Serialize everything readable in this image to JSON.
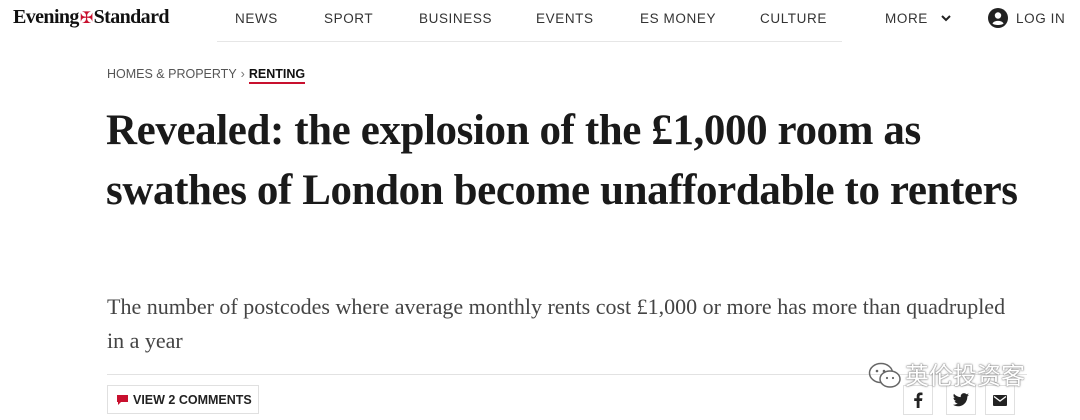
{
  "brand": {
    "logo_left": "Evening",
    "logo_right": "Standard",
    "accent": "#c8102e"
  },
  "nav": {
    "items": [
      "NEWS",
      "SPORT",
      "BUSINESS",
      "EVENTS",
      "ES MONEY",
      "CULTURE"
    ],
    "more_label": "MORE",
    "login_label": "LOG IN"
  },
  "breadcrumb": {
    "parent": "HOMES & PROPERTY",
    "separator": "›",
    "current": "RENTING"
  },
  "article": {
    "headline": "Revealed: the explosion of the £1,000 room as swathes of London become unaffordable to renters",
    "standfirst": "The number of postcodes where average monthly rents cost £1,000 or more has more than quadrupled in a year",
    "comments_label": "VIEW 2 COMMENTS"
  },
  "share": {
    "icons": [
      "facebook-icon",
      "twitter-icon",
      "email-icon"
    ]
  },
  "watermark": {
    "text": "英伦投资客"
  }
}
